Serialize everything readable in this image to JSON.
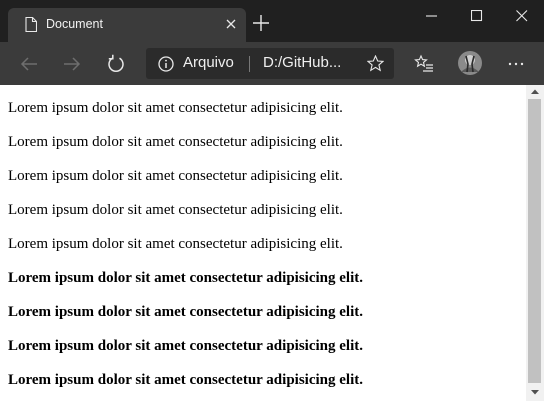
{
  "tab": {
    "title": "Document"
  },
  "address": {
    "label": "Arquivo",
    "url": "D:/GitHub..."
  },
  "content": {
    "lines": [
      "Lorem ipsum dolor sit amet consectetur adipisicing elit.",
      "Lorem ipsum dolor sit amet consectetur adipisicing elit.",
      "Lorem ipsum dolor sit amet consectetur adipisicing elit.",
      "Lorem ipsum dolor sit amet consectetur adipisicing elit.",
      "Lorem ipsum dolor sit amet consectetur adipisicing elit.",
      "Lorem ipsum dolor sit amet consectetur adipisicing elit.",
      "Lorem ipsum dolor sit amet consectetur adipisicing elit.",
      "Lorem ipsum dolor sit amet consectetur adipisicing elit.",
      "Lorem ipsum dolor sit amet consectetur adipisicing elit."
    ]
  },
  "icons": {
    "tab": "document-icon",
    "close": "close-icon",
    "new_tab": "plus-icon",
    "back": "arrow-left-icon",
    "forward": "arrow-right-icon",
    "refresh": "refresh-icon",
    "info": "info-icon",
    "favorite": "star-icon",
    "favorites_bar": "favorites-icon",
    "profile": "avatar",
    "menu": "more-icon",
    "minimize": "minimize-icon",
    "maximize": "maximize-icon",
    "window_close": "close-icon"
  },
  "colors": {
    "titlebar": "#202020",
    "toolbar": "#3b3b3b",
    "address_bg": "#2b2b2b",
    "scroll_thumb": "#c1c1c1"
  }
}
